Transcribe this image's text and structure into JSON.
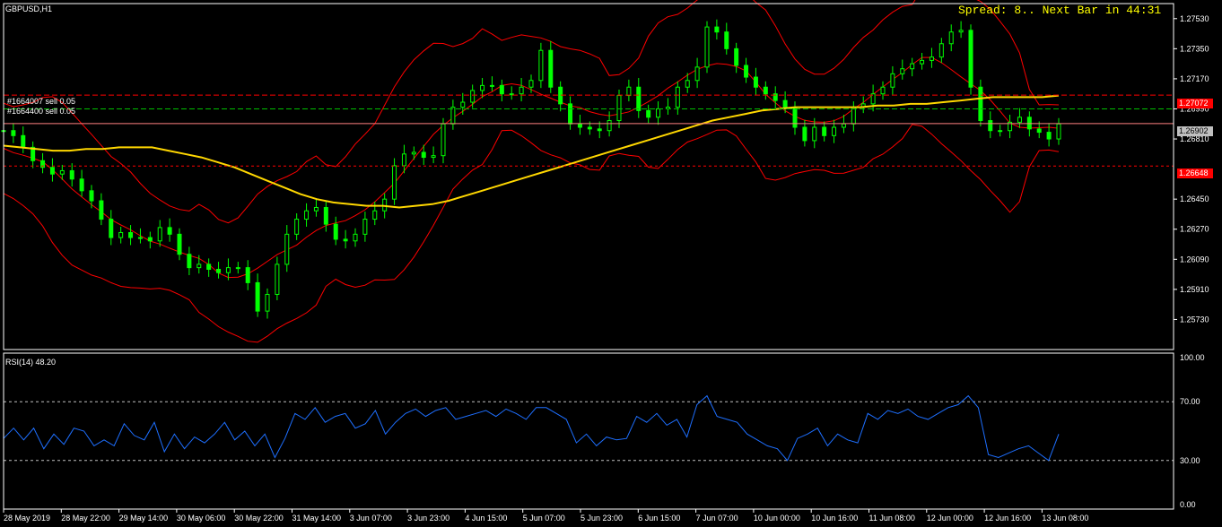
{
  "header": {
    "symbol": "GBPUSD,H1",
    "spread_text": "Spread: 8.. Next Bar in 44:31"
  },
  "orders": [
    {
      "label": "#1664007 sell 0.05",
      "price": 1.27072
    },
    {
      "label": "#1664400 sell 0.05",
      "price": 1.2699
    }
  ],
  "price_tags": {
    "order_tag": "1.27072",
    "current_tag": "1.26902",
    "stop_tag": "1.26648"
  },
  "price_levels": {
    "current": 1.26902,
    "stop": 1.26648
  },
  "price_axis": {
    "min": 1.2555,
    "max": 1.2762,
    "ticks": [
      "1.27530",
      "1.27350",
      "1.27170",
      "1.26990",
      "1.26810",
      "1.26450",
      "1.26270",
      "1.26090",
      "1.25910",
      "1.25730"
    ]
  },
  "rsi": {
    "label": "RSI(14) 48.20",
    "ticks": [
      "100.00",
      "70.00",
      "30.00",
      "0.00"
    ],
    "levels": [
      70,
      30
    ]
  },
  "time_axis": {
    "labels": [
      "28 May 2019",
      "28 May 22:00",
      "29 May 14:00",
      "30 May 06:00",
      "30 May 22:00",
      "31 May 14:00",
      "3 Jun 07:00",
      "3 Jun 23:00",
      "4 Jun 15:00",
      "5 Jun 07:00",
      "5 Jun 23:00",
      "6 Jun 15:00",
      "7 Jun 07:00",
      "10 Jun 00:00",
      "10 Jun 16:00",
      "11 Jun 08:00",
      "12 Jun 00:00",
      "12 Jun 16:00",
      "13 Jun 08:00"
    ]
  },
  "colors": {
    "candle": "#00ff00",
    "bollinger": "#ff0000",
    "moving_average": "#ffd700",
    "rsi_line": "#1e6fff",
    "order_line": "#ff0000",
    "current_line": "#ff8080",
    "spread_text": "#ffff00",
    "grid_dash": "#c0c0c0",
    "order_tag_bg": "#ff0000",
    "current_tag_bg": "#c0c0c0"
  },
  "chart_data": {
    "type": "line",
    "series": [
      {
        "values": [
          1.2686,
          1.2683,
          1.2676,
          1.2668,
          1.2664,
          1.266,
          1.2662,
          1.2657,
          1.265,
          1.2644,
          1.2633,
          1.2622,
          1.2625,
          1.2622,
          1.2622,
          1.262,
          1.2628,
          1.2624,
          1.2612,
          1.2604,
          1.2606,
          1.2603,
          1.2601,
          1.2604,
          1.2604,
          1.2595,
          1.2578,
          1.2588,
          1.2606,
          1.2624,
          1.2633,
          1.2638,
          1.264,
          1.263,
          1.2621,
          1.262,
          1.2624,
          1.2633,
          1.2638,
          1.2645,
          1.2665,
          1.2672,
          1.2673,
          1.267,
          1.2671,
          1.269,
          1.27,
          1.2703,
          1.271,
          1.2713,
          1.2713,
          1.2708,
          1.2708,
          1.2712,
          1.2716,
          1.2734,
          1.2712,
          1.2702,
          1.269,
          1.2688,
          1.2687,
          1.2686,
          1.2692,
          1.2707,
          1.2712,
          1.2698,
          1.2694,
          1.2699,
          1.27,
          1.2712,
          1.2716,
          1.2724,
          1.2748,
          1.2745,
          1.2735,
          1.2725,
          1.2718,
          1.2712,
          1.2708,
          1.2704,
          1.27,
          1.2688,
          1.268,
          1.2688,
          1.2683,
          1.2688,
          1.269,
          1.27,
          1.2702,
          1.2708,
          1.2712,
          1.272,
          1.2723,
          1.2726,
          1.2728,
          1.273,
          1.2738,
          1.2745,
          1.2746,
          1.2712,
          1.2692,
          1.2686,
          1.2686,
          1.2691,
          1.2694,
          1.2687,
          1.2685,
          1.2681,
          1.269
        ]
      },
      {
        "values": [
          1.2677,
          1.2676,
          1.2675,
          1.2674,
          1.2674,
          1.2675,
          1.2675,
          1.2676,
          1.2676,
          1.2676,
          1.2674,
          1.2672,
          1.267,
          1.2667,
          1.2664,
          1.266,
          1.2656,
          1.2652,
          1.2648,
          1.2645,
          1.2643,
          1.2642,
          1.2641,
          1.2641,
          1.264,
          1.2641,
          1.2642,
          1.2644,
          1.2647,
          1.265,
          1.2653,
          1.2656,
          1.2659,
          1.2662,
          1.2665,
          1.2668,
          1.2671,
          1.2674,
          1.2677,
          1.268,
          1.2683,
          1.2686,
          1.2689,
          1.2692,
          1.2694,
          1.2696,
          1.2698,
          1.2699,
          1.27,
          1.27,
          1.27,
          1.27,
          1.27,
          1.2701,
          1.2701,
          1.2702,
          1.2702,
          1.2703,
          1.2704,
          1.2705,
          1.2706,
          1.2706,
          1.2706,
          1.2706,
          1.2707
        ]
      }
    ],
    "rsi_values": [
      45,
      52,
      44,
      52,
      38,
      48,
      41,
      52,
      50,
      40,
      44,
      40,
      55,
      47,
      44,
      56,
      36,
      48,
      38,
      46,
      42,
      48,
      56,
      44,
      50,
      40,
      48,
      32,
      45,
      62,
      58,
      66,
      56,
      60,
      62,
      52,
      55,
      64,
      48,
      56,
      62,
      65,
      60,
      64,
      66,
      58,
      60,
      62,
      64,
      60,
      65,
      62,
      58,
      66,
      66,
      62,
      58,
      42,
      48,
      40,
      46,
      44,
      45,
      60,
      56,
      62,
      54,
      58,
      46,
      68,
      74,
      60,
      58,
      56,
      48,
      44,
      40,
      38,
      30,
      45,
      48,
      52,
      40,
      48,
      44,
      42,
      62,
      58,
      64,
      62,
      65,
      60,
      58,
      62,
      66,
      68,
      74,
      66,
      34,
      32,
      35,
      38,
      40,
      35,
      30,
      48
    ]
  }
}
